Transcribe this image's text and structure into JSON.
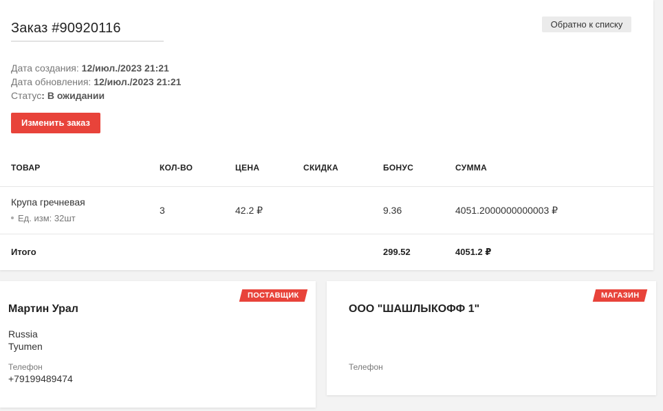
{
  "order": {
    "title": "Заказ #90920116",
    "back_label": "Обратно к списку",
    "created_label": "Дата создания: ",
    "created_value": "12/июл./2023 21:21",
    "updated_label": "Дата обновления: ",
    "updated_value": "12/июл./2023 21:21",
    "status_label": "Статус",
    "status_value": ": В ожидании",
    "edit_label": "Изменить заказ"
  },
  "table": {
    "headers": [
      "ТОВАР",
      "КОЛ-ВО",
      "ЦЕНА",
      "СКИДКА",
      "БОНУС",
      "СУММА"
    ],
    "rows": [
      {
        "product": "Крупа гречневая",
        "unit": "Ед. изм: 32шт",
        "qty": "3",
        "price": "42.2 ₽",
        "discount": "",
        "bonus": "9.36",
        "sum": "4051.2000000000003 ₽"
      }
    ],
    "total": {
      "label": "Итого",
      "bonus": "299.52",
      "sum": "4051.2 ₽"
    }
  },
  "supplier": {
    "badge": "ПОСТАВЩИК",
    "name": "Мартин Урал",
    "country": "Russia",
    "city": "Tyumen",
    "phone_label": "Телефон",
    "phone": "+79199489474"
  },
  "store": {
    "badge": "МАГАЗИН",
    "name": "ООО \"ШАШЛЫКОФФ 1\"",
    "phone_label": "Телефон",
    "phone": ""
  },
  "colors": {
    "accent": "#e8433a",
    "background": "#f3f3f3"
  }
}
